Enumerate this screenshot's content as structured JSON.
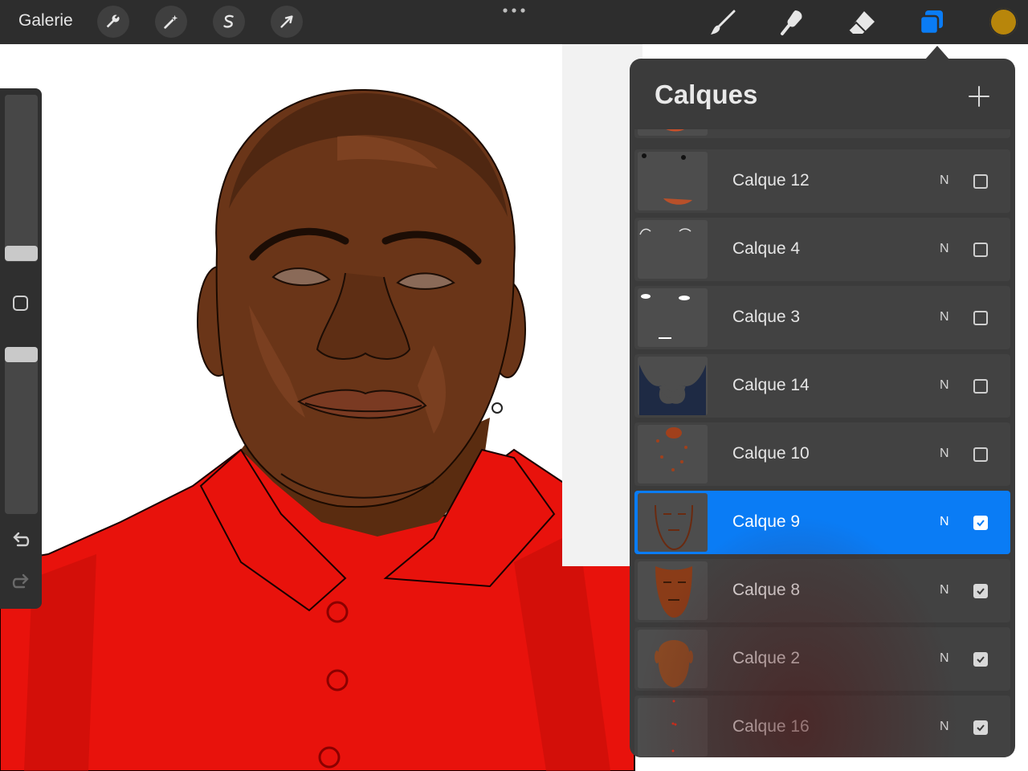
{
  "toolbar": {
    "gallery_label": "Galerie",
    "left_tools": [
      "wrench-icon",
      "magic-wand-icon",
      "selection-icon",
      "transform-arrow-icon"
    ],
    "right_tools": [
      "brush-icon",
      "smudge-icon",
      "eraser-icon",
      "layers-icon"
    ],
    "active_tool": "layers-icon",
    "current_color": "#b8860b"
  },
  "sidebar": {
    "brush_size_level": 0.6,
    "opacity_level": 0.8,
    "icons": [
      "modifier-square-icon",
      "undo-icon",
      "redo-icon"
    ]
  },
  "layers_panel": {
    "title": "Calques",
    "add_icon": "plus-icon",
    "layers": [
      {
        "name": "Calque 12",
        "blend": "N",
        "visible": false,
        "active": false,
        "thumb": "mouth-dots"
      },
      {
        "name": "Calque 4",
        "blend": "N",
        "visible": false,
        "active": false,
        "thumb": "brows-white"
      },
      {
        "name": "Calque 3",
        "blend": "N",
        "visible": false,
        "active": false,
        "thumb": "eye-highlights"
      },
      {
        "name": "Calque 14",
        "blend": "N",
        "visible": false,
        "active": false,
        "thumb": "collar-navy"
      },
      {
        "name": "Calque 10",
        "blend": "N",
        "visible": false,
        "active": false,
        "thumb": "face-spots"
      },
      {
        "name": "Calque 9",
        "blend": "N",
        "visible": true,
        "active": true,
        "thumb": "face-outline"
      },
      {
        "name": "Calque 8",
        "blend": "N",
        "visible": true,
        "active": false,
        "thumb": "face-shading"
      },
      {
        "name": "Calque 2",
        "blend": "N",
        "visible": true,
        "active": false,
        "thumb": "head-silhouette"
      },
      {
        "name": "Calque 16",
        "blend": "N",
        "visible": true,
        "active": false,
        "thumb": "red-marks"
      }
    ]
  },
  "colors": {
    "accent": "#0a7cf5",
    "toolbar_bg": "#2d2d2d",
    "panel_bg": "#3b3b3b",
    "shirt": "#e8120c",
    "skin": "#6a3518"
  }
}
